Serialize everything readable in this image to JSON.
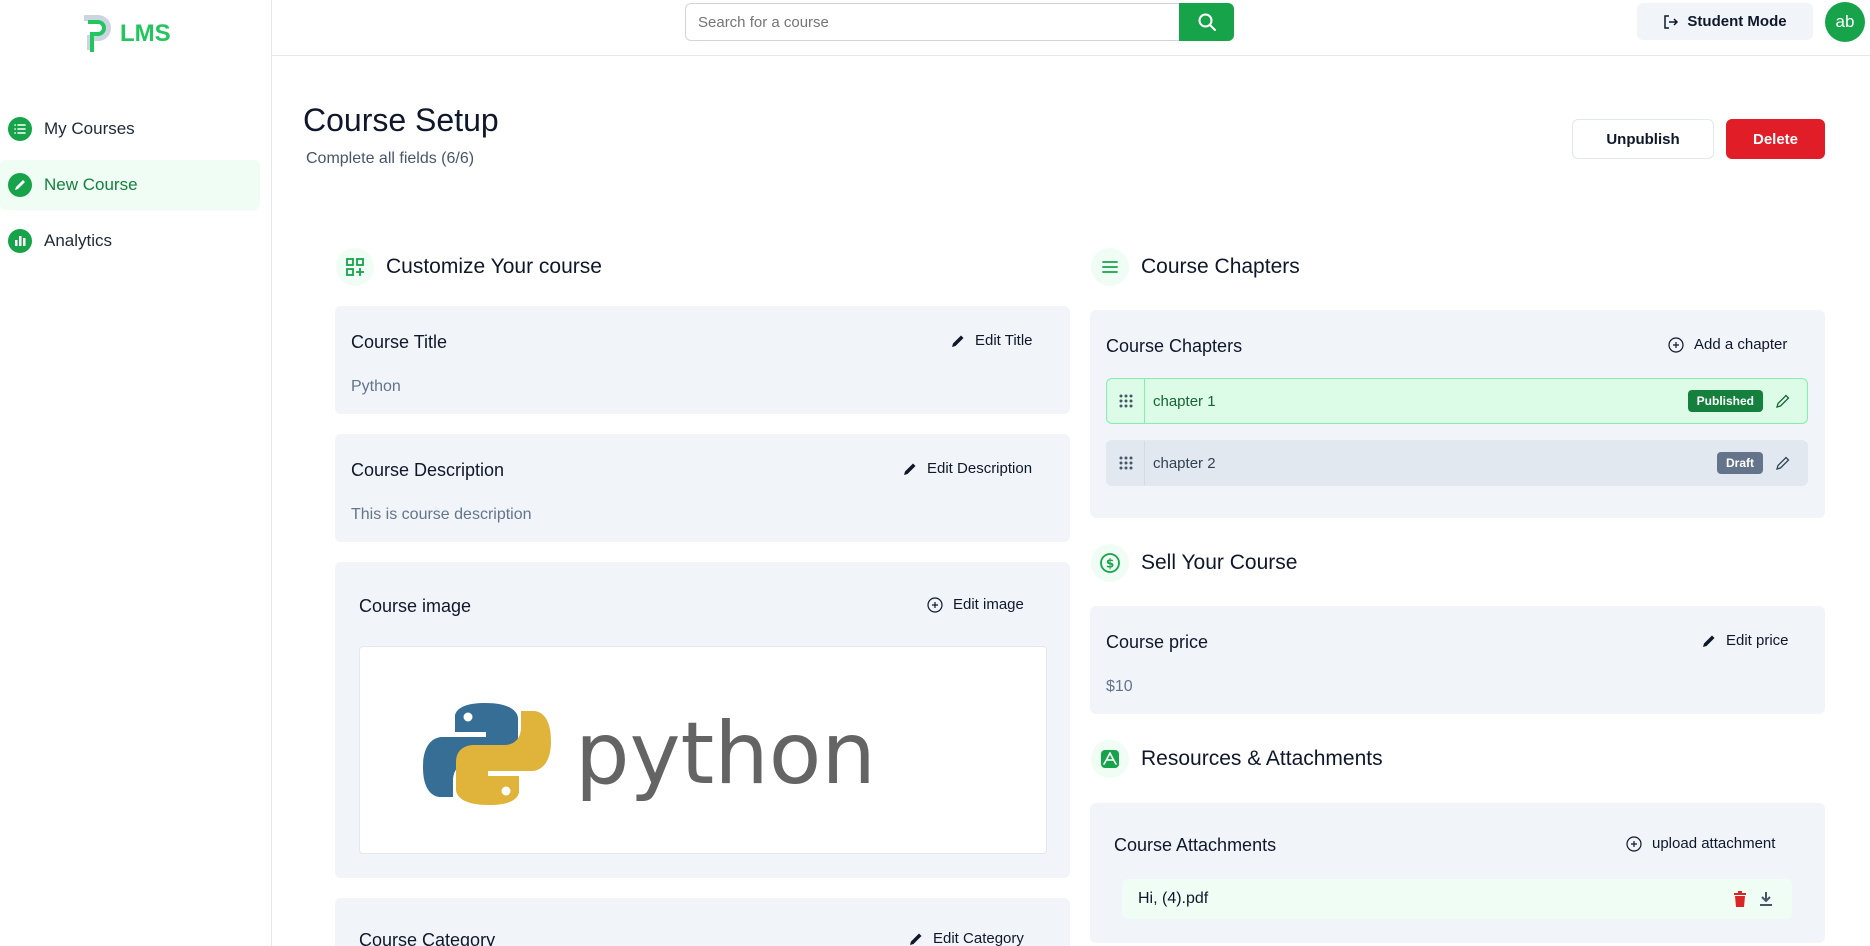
{
  "brand": {
    "name": "LMS",
    "colors": {
      "primary": "#16a34a",
      "danger": "#e11d28",
      "card": "#f1f5f9"
    }
  },
  "sidebar": {
    "items": [
      {
        "label": "My Courses",
        "icon": "list-icon"
      },
      {
        "label": "New Course",
        "icon": "pencil-icon"
      },
      {
        "label": "Analytics",
        "icon": "bar-chart-icon"
      }
    ]
  },
  "topbar": {
    "search": {
      "placeholder": "Search for a course"
    },
    "student_mode_label": "Student Mode",
    "avatar_initials": "ab"
  },
  "header": {
    "title": "Course Setup",
    "subtitle": "Complete all fields (6/6)",
    "unpublish_label": "Unpublish",
    "delete_label": "Delete"
  },
  "customize": {
    "heading": "Customize Your course",
    "title_card": {
      "label": "Course Title",
      "action": "Edit Title",
      "value": "Python"
    },
    "description_card": {
      "label": "Course Description",
      "action": "Edit Description",
      "value": "This is course description"
    },
    "image_card": {
      "label": "Course image",
      "action": "Edit image",
      "image_text": "python"
    },
    "category_card": {
      "label": "Course Category",
      "action": "Edit Category"
    }
  },
  "chapters": {
    "heading": "Course Chapters",
    "card_label": "Course Chapters",
    "add_label": "Add a chapter",
    "items": [
      {
        "label": "chapter 1",
        "status": "Published"
      },
      {
        "label": "chapter 2",
        "status": "Draft"
      }
    ]
  },
  "sell": {
    "heading": "Sell Your Course",
    "card_label": "Course price",
    "action": "Edit price",
    "value": "$10"
  },
  "resources": {
    "heading": "Resources & Attachments",
    "card_label": "Course Attachments",
    "upload_label": "upload attachment",
    "files": [
      {
        "name": "Hi, (4).pdf"
      }
    ]
  }
}
